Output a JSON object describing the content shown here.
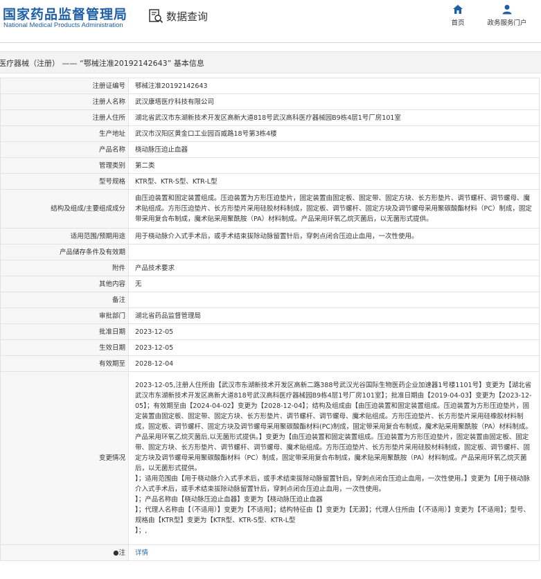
{
  "header": {
    "logo_cn": "国家药品监督管理局",
    "logo_en": "National Medical Products Administration",
    "query_label": "数据查询",
    "nav": [
      {
        "label": "首页",
        "icon": "home-icon"
      },
      {
        "label": "政务服务门户",
        "icon": "user-icon"
      }
    ]
  },
  "breadcrumb": "医疗器械（注册） —— “鄂械注准20192142643” 基本信息",
  "rows": [
    {
      "label": "注册证编号",
      "value": "鄂械注准20192142643"
    },
    {
      "label": "注册人名称",
      "value": "武汉康塔医疗科技有限公司"
    },
    {
      "label": "注册人住所",
      "value": "湖北省武汉市东湖新技术开发区高新大道818号武汉高科医疗器械园B9栋4层1号厂房101室"
    },
    {
      "label": "生产地址",
      "value": "武汉市汉阳区黄金口工业园百威路18号第3栋4楼"
    },
    {
      "label": "产品名称",
      "value": "桡动脉压迫止血器"
    },
    {
      "label": "管理类别",
      "value": "第二类"
    },
    {
      "label": "型号规格",
      "value": "KTR型、KTR-S型、KTR-L型"
    },
    {
      "label": "结构及组成/主要组成成分",
      "value": "由压迫装置和固定装置组成。压迫装置为方形压迫垫片，固定装置由固定板、固定带、固定方块、长方形垫片、调节螺杆、调节螺母、魔术贴组成。方形压迫垫片、长方形垫片采用硅胶材料制成，固定板、调节螺杆、固定方块及调节螺母采用聚碳酸酯材料（PC）制成，固定带采用复合布制成，魔术贴采用聚酰胺（PA）材料制成。产品采用环氧乙烷灭菌后，以无菌形式提供。"
    },
    {
      "label": "适用范围/预期用途",
      "value": "用于桡动脉介入式手术后，或手术结束拔除动脉留置针后，穿刺点闭合压迫止血用，一次性使用。"
    },
    {
      "label": "产品储存条件及有效期",
      "value": ""
    },
    {
      "label": "附件",
      "value": "产品技术要求"
    },
    {
      "label": "其他内容",
      "value": "无"
    },
    {
      "label": "备注",
      "value": ""
    },
    {
      "label": "审批部门",
      "value": "湖北省药品监督管理局"
    },
    {
      "label": "批准日期",
      "value": "2023-12-05"
    },
    {
      "label": "生效日期",
      "value": "2023-12-05"
    },
    {
      "label": "有效期至",
      "value": "2028-12-04"
    },
    {
      "label": "变更情况",
      "value": "2023-12-05,注册人住所由【武汉市东湖新技术开发区高新二路388号武汉光谷国际生物医药企业加速器1号楼1101号】变更为【湖北省武汉市东湖新技术开发区高新大道818号武汉高科医疗器械园B9栋4层1号厂房101室】；批准日期由【2019-04-03】变更为【2023-12-05】；有效期至由【2024-04-02】变更为【2028-12-04】；结构及组成由【由压迫装置和固定装置组成。压迫装置为方形压迫垫片，固定装置由固定板、固定带、固定方块、长方形垫片、调节螺杆、调节螺母、魔术贴组成。方形压迫垫片、长方形垫片采用硅橡胶材料制成，固定板、调节螺杆、固定方块及调节螺母采用聚碳酸酯材料(PC)制成，固定带采用复合布制成，魔术贴采用聚酰胺（PA）材料制成。产品采用环氧乙烷灭菌后,以无菌形式提供。】变更为【由压迫装置和固定装置组成。压迫装置为方形压迫垫片，固定装置由固定板、固定带、固定方块、长方形垫片、调节螺杆、调节螺母、魔术贴组成。方形压迫垫片、长方形垫片采用硅胶材料制成，固定板、调节螺杆、固定方块及调节螺母采用聚碳酸酯材料（PC）制成，固定带采用复合布制成，魔术贴采用聚酰胺（PA）材料制成。产品采用环氧乙烷灭菌后，以无菌形式提供。\n】；适用范围由【用于桡动脉介入式手术后，或手术结束拔除动脉留置针后，穿刺点闭合压迫止血用，一次性使用。】变更为【用于桡动脉介入式手术后，或手术结束拔除动脉留置针后，穿刺点闭合压迫止血用，一次性使用。\n】；产品名称由【桡动脉压迫止血器】变更为【桡动脉压迫止血器\n】；代理人名称由【（不适用）】变更为【不适用】；结构特征由【】变更为【无源】；代理人住所由【（不适用）】变更为【不适用】；型号、规格由【KTR型】变更为【KTR型、KTR-S型、KTR-L型\n】；,"
    },
    {
      "label": "注",
      "mark": "●",
      "value": "详情",
      "is_link": true
    }
  ]
}
